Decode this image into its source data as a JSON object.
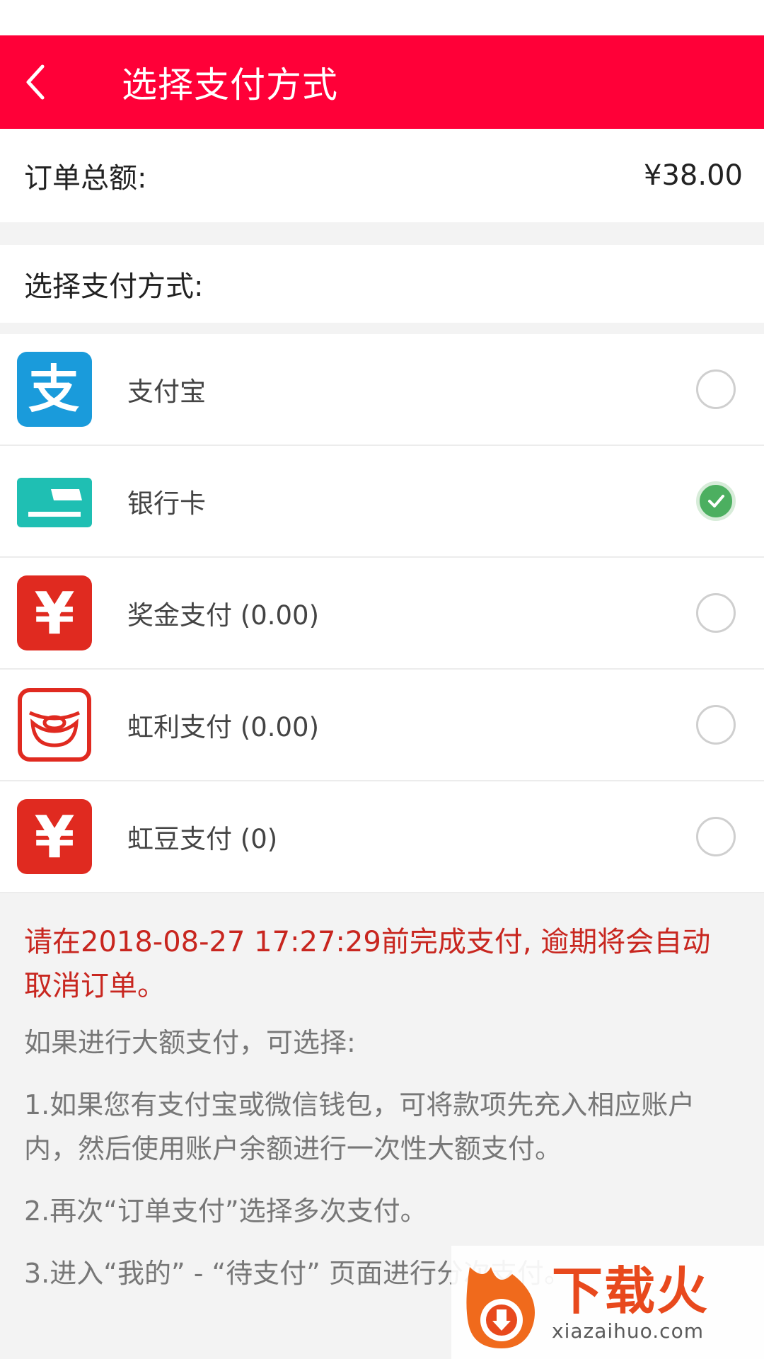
{
  "colors": {
    "brand": "#ff0038",
    "warn": "#c8261f",
    "check": "#4caf60"
  },
  "header": {
    "title": "选择支付方式",
    "back_icon": "chevron-left-icon"
  },
  "order": {
    "total_label": "订单总额:",
    "total_value": "¥38.00"
  },
  "section": {
    "label": "选择支付方式:"
  },
  "payment_methods": [
    {
      "label": "支付宝",
      "icon": "alipay-icon",
      "selected": false
    },
    {
      "label": "银行卡",
      "icon": "bank-card-icon",
      "selected": true
    },
    {
      "label": "奖金支付 (0.00)",
      "icon": "yen-icon",
      "selected": false
    },
    {
      "label": "虹利支付 (0.00)",
      "icon": "ingot-icon",
      "selected": false
    },
    {
      "label": "虹豆支付 (0)",
      "icon": "yen-icon",
      "selected": false
    }
  ],
  "notice": {
    "deadline": "请在2018-08-27 17:27:29前完成支付, 逾期将会自动取消订单。",
    "large_title": "如果进行大额支付，可选择:",
    "tips": [
      "1.如果您有支付宝或微信钱包，可将款项先充入相应账户内，然后使用账户余额进行一次性大额支付。",
      "2.再次“订单支付”选择多次支付。",
      "3.进入“我的” - “待支付” 页面进行分次支付。"
    ]
  },
  "watermark": {
    "text": "下载火",
    "domain": "xiazaihuo.com"
  }
}
